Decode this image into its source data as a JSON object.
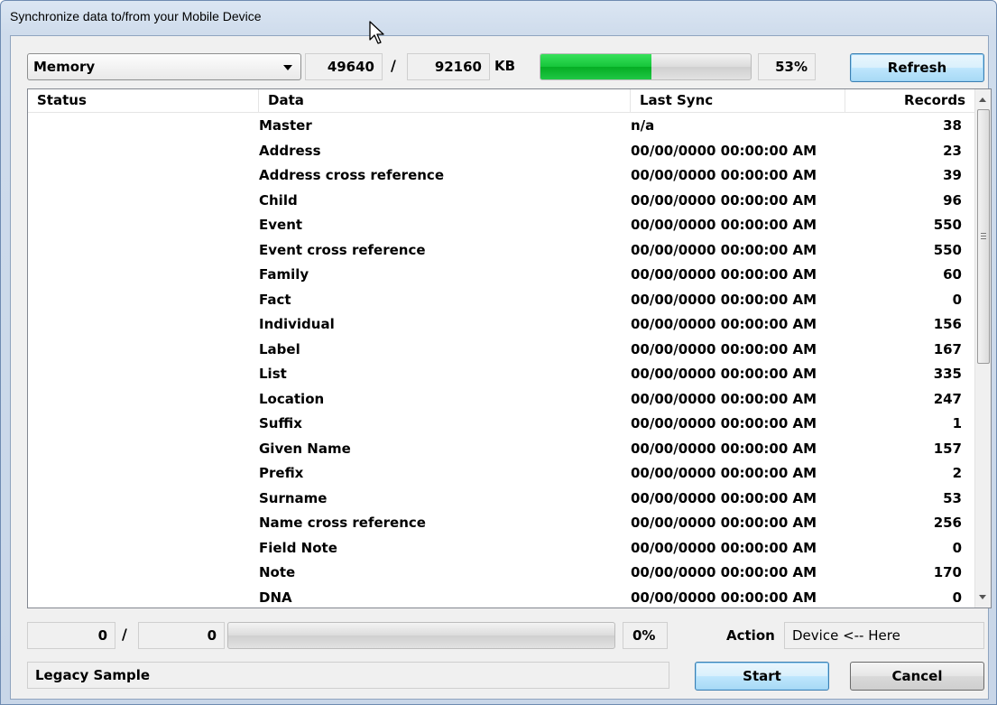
{
  "window": {
    "title": "Synchronize data to/from your Mobile Device"
  },
  "memory": {
    "selected": "Memory",
    "used": "49640",
    "separator": "/",
    "total": "92160",
    "unit": "KB",
    "progress_fraction": 0.53,
    "percent": "53%"
  },
  "buttons": {
    "refresh": "Refresh",
    "start": "Start",
    "cancel": "Cancel"
  },
  "table": {
    "columns": {
      "status": "Status",
      "data": "Data",
      "last_sync": "Last Sync",
      "records": "Records"
    },
    "rows": [
      {
        "data": "Master",
        "last_sync": "n/a",
        "records": "38"
      },
      {
        "data": "Address",
        "last_sync": "00/00/0000 00:00:00 AM",
        "records": "23"
      },
      {
        "data": "Address cross reference",
        "last_sync": "00/00/0000 00:00:00 AM",
        "records": "39"
      },
      {
        "data": "Child",
        "last_sync": "00/00/0000 00:00:00 AM",
        "records": "96"
      },
      {
        "data": "Event",
        "last_sync": "00/00/0000 00:00:00 AM",
        "records": "550"
      },
      {
        "data": "Event cross reference",
        "last_sync": "00/00/0000 00:00:00 AM",
        "records": "550"
      },
      {
        "data": "Family",
        "last_sync": "00/00/0000 00:00:00 AM",
        "records": "60"
      },
      {
        "data": "Fact",
        "last_sync": "00/00/0000 00:00:00 AM",
        "records": "0"
      },
      {
        "data": "Individual",
        "last_sync": "00/00/0000 00:00:00 AM",
        "records": "156"
      },
      {
        "data": "Label",
        "last_sync": "00/00/0000 00:00:00 AM",
        "records": "167"
      },
      {
        "data": "List",
        "last_sync": "00/00/0000 00:00:00 AM",
        "records": "335"
      },
      {
        "data": "Location",
        "last_sync": "00/00/0000 00:00:00 AM",
        "records": "247"
      },
      {
        "data": "Suffix",
        "last_sync": "00/00/0000 00:00:00 AM",
        "records": "1"
      },
      {
        "data": "Given Name",
        "last_sync": "00/00/0000 00:00:00 AM",
        "records": "157"
      },
      {
        "data": "Prefix",
        "last_sync": "00/00/0000 00:00:00 AM",
        "records": "2"
      },
      {
        "data": "Surname",
        "last_sync": "00/00/0000 00:00:00 AM",
        "records": "53"
      },
      {
        "data": "Name cross reference",
        "last_sync": "00/00/0000 00:00:00 AM",
        "records": "256"
      },
      {
        "data": "Field Note",
        "last_sync": "00/00/0000 00:00:00 AM",
        "records": "0"
      },
      {
        "data": "Note",
        "last_sync": "00/00/0000 00:00:00 AM",
        "records": "170"
      },
      {
        "data": "DNA",
        "last_sync": "00/00/0000 00:00:00 AM",
        "records": "0"
      }
    ]
  },
  "sync": {
    "done": "0",
    "separator": "/",
    "total": "0",
    "progress_fraction": 0,
    "percent": "0%",
    "action_label": "Action",
    "action_value": "Device <-- Here"
  },
  "status": {
    "file_name": "Legacy Sample"
  },
  "icons": {
    "dropdown": "chevron-down-icon",
    "cursor": "mouse-pointer-icon",
    "scroll_up": "arrow-up-icon",
    "scroll_down": "arrow-down-icon"
  },
  "colors": {
    "progress_green": "#16c63b",
    "title_bg": "#cfdcec"
  }
}
